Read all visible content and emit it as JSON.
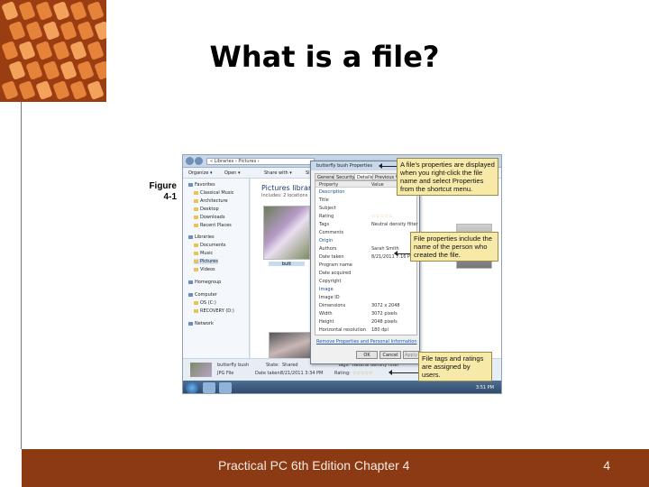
{
  "slide": {
    "title": "What is a file?",
    "figure_label_1": "Figure",
    "figure_label_2": "4-1"
  },
  "explorer": {
    "address": "« Libraries › Pictures ›",
    "toolbar": [
      "Organize ▾",
      "Open ▾",
      "Share with ▾",
      "Sli"
    ],
    "nav": [
      {
        "label": "Favorites",
        "head": true
      },
      {
        "label": "Classical Music"
      },
      {
        "label": "Architecture"
      },
      {
        "label": "Desktop"
      },
      {
        "label": "Downloads"
      },
      {
        "label": "Recent Places"
      },
      {
        "label": "Libraries",
        "head": true
      },
      {
        "label": "Documents"
      },
      {
        "label": "Music"
      },
      {
        "label": "Pictures"
      },
      {
        "label": "Videos"
      },
      {
        "label": "Homegroup",
        "head": true
      },
      {
        "label": "Computer",
        "head": true
      },
      {
        "label": "OS (C:)"
      },
      {
        "label": "RECOVERY (D:)"
      },
      {
        "label": "Network",
        "head": true
      }
    ],
    "library_title": "Pictures librar",
    "library_sub": "Includes: 2 locations",
    "thumb_caption": "butt",
    "details": {
      "name": "butterfly bush",
      "type": "JPG File",
      "state_label": "State:",
      "state_value": "Shared",
      "date_label": "Date taken:",
      "date_value": "8/21/2011 3:34 PM",
      "tags_label": "Tags:",
      "tags_value": "Neutral density filter",
      "rating_label": "Rating:",
      "rating_value": "☆☆☆☆☆"
    },
    "clock": "3:51 PM"
  },
  "dialog": {
    "title": "butterfly bush Properties",
    "tabs": [
      "General",
      "Security",
      "Details",
      "Previous Ve"
    ],
    "columns": [
      "Property",
      "Value"
    ],
    "rows": [
      {
        "label": "Description",
        "section": true
      },
      {
        "label": "Title"
      },
      {
        "label": "Subject"
      },
      {
        "label": "Rating",
        "value": "☆☆☆☆☆",
        "stars": true
      },
      {
        "label": "Tags",
        "value": "Neutral density filter"
      },
      {
        "label": "Comments"
      },
      {
        "label": "Origin",
        "section": true
      },
      {
        "label": "Authors",
        "value": "Sarah Smith"
      },
      {
        "label": "Date taken",
        "value": "8/21/2011 7:16 PM"
      },
      {
        "label": "Program name"
      },
      {
        "label": "Date acquired"
      },
      {
        "label": "Copyright"
      },
      {
        "label": "Image",
        "section": true
      },
      {
        "label": "Image ID"
      },
      {
        "label": "Dimensions",
        "value": "3072 x 2048"
      },
      {
        "label": "Width",
        "value": "3072 pixels"
      },
      {
        "label": "Height",
        "value": "2048 pixels"
      },
      {
        "label": "Horizontal resolution",
        "value": "180 dpi"
      }
    ],
    "link": "Remove Properties and Personal Information",
    "buttons": [
      "OK",
      "Cancel",
      "Apply"
    ]
  },
  "callouts": {
    "c1": "A file's properties are displayed when you right-click the file name and select Properties from the shortcut menu.",
    "c2": "File properties include the name of the person who created the file.",
    "c3": "File tags and ratings are assigned by users."
  },
  "footer": {
    "text": "Practical PC 6th Edition Chapter 4",
    "page": "4"
  },
  "colors": {
    "accent": "#8b3a14",
    "corner_dot": "#e6833a",
    "callout": "#f7e9a8"
  }
}
